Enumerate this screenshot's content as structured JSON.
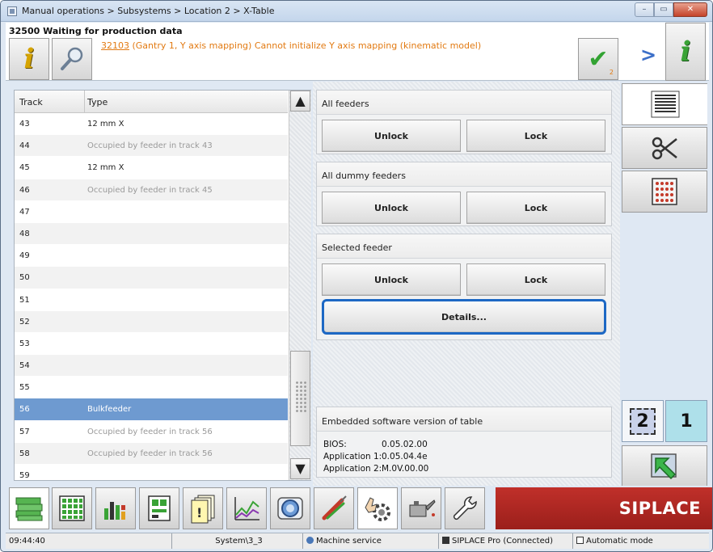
{
  "window": {
    "title": "Manual operations > Subsystems > Location 2 > X-Table",
    "minimize_label": "–",
    "maximize_label": "▭",
    "close_label": "✕"
  },
  "message": {
    "status": "32500 Waiting for production data",
    "error_code": "32103",
    "error_text": " (Gantry 1, Y axis mapping) Cannot initialize Y axis mapping (kinematic model)",
    "ack_count": "2"
  },
  "track_table": {
    "headers": {
      "track": "Track",
      "type": "Type"
    },
    "rows": [
      {
        "track": "43",
        "type": "12 mm X",
        "dim": false
      },
      {
        "track": "44",
        "type": "Occupied by feeder in track 43",
        "dim": true
      },
      {
        "track": "45",
        "type": "12 mm X",
        "dim": false
      },
      {
        "track": "46",
        "type": "Occupied by feeder in track 45",
        "dim": true
      },
      {
        "track": "47",
        "type": "",
        "dim": false
      },
      {
        "track": "48",
        "type": "",
        "dim": false
      },
      {
        "track": "49",
        "type": "",
        "dim": false
      },
      {
        "track": "50",
        "type": "",
        "dim": false
      },
      {
        "track": "51",
        "type": "",
        "dim": false
      },
      {
        "track": "52",
        "type": "",
        "dim": false
      },
      {
        "track": "53",
        "type": "",
        "dim": false
      },
      {
        "track": "54",
        "type": "",
        "dim": false
      },
      {
        "track": "55",
        "type": "",
        "dim": false
      },
      {
        "track": "56",
        "type": "Bulkfeeder",
        "dim": false,
        "selected": true
      },
      {
        "track": "57",
        "type": "Occupied by feeder in track 56",
        "dim": true
      },
      {
        "track": "58",
        "type": "Occupied by feeder in track 56",
        "dim": true
      },
      {
        "track": "59",
        "type": "",
        "dim": false
      }
    ]
  },
  "groups": {
    "all_feeders": {
      "title": "All feeders",
      "unlock": "Unlock",
      "lock": "Lock"
    },
    "all_dummy": {
      "title": "All dummy feeders",
      "unlock": "Unlock",
      "lock": "Lock"
    },
    "selected": {
      "title": "Selected feeder",
      "unlock": "Unlock",
      "lock": "Lock",
      "details": "Details..."
    }
  },
  "software": {
    "title": "Embedded software version of table",
    "bios_label": "BIOS:",
    "bios_value": "0.05.02.00",
    "app1_label": "Application 1:",
    "app1_value": "0.05.04.4e",
    "app2_label": "Application 2:",
    "app2_value": "M.0V.00.00"
  },
  "side": {
    "location_2": "2",
    "location_1": "1"
  },
  "brand": "SIPLACE",
  "statusbar": {
    "time": "09:44:40",
    "system": "System\\3_3",
    "user": "Machine service",
    "connection": "SIPLACE Pro (Connected)",
    "mode": "Automatic mode"
  },
  "colors": {
    "accent_orange": "#e27a12",
    "selection_blue": "#6e9ad0",
    "focus_blue": "#1d68c4",
    "brand_red": "#b0261f"
  }
}
